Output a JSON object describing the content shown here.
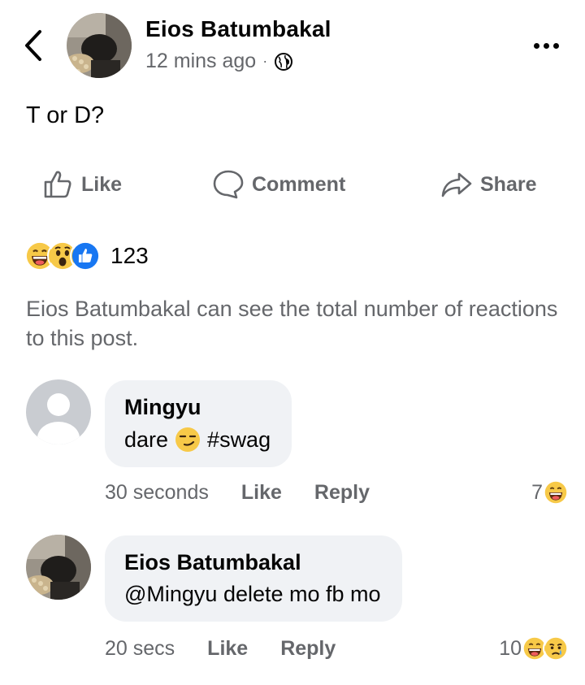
{
  "post": {
    "author": "Eios Batumbakal",
    "time": "12 mins ago",
    "dot": "·",
    "text": "T or D?"
  },
  "actions": {
    "like": "Like",
    "comment": "Comment",
    "share": "Share"
  },
  "reactions": {
    "icons": [
      "laugh-emoji",
      "wow-emoji",
      "like-thumb"
    ],
    "count": "123"
  },
  "notice": "Eios Batumbakal can see the total number of reactions to this post.",
  "comments": [
    {
      "name": "Mingyu",
      "text_before": "dare",
      "emoji": "smirk-emoji",
      "text_after": "#swag",
      "time": "30 seconds",
      "like": "Like",
      "reply": "Reply",
      "reaction_count": "7",
      "reaction_icons": [
        "laugh-emoji"
      ]
    },
    {
      "name": "Eios Batumbakal",
      "text": "@Mingyu delete mo fb mo",
      "time": "20 secs",
      "like": "Like",
      "reply": "Reply",
      "reaction_count": "10",
      "reaction_icons": [
        "laugh-emoji",
        "sad-emoji"
      ]
    }
  ],
  "colors": {
    "secondary_text": "#65676b",
    "bubble_bg": "#f0f2f5",
    "like_blue": "#1877f2",
    "emoji_yellow": "#f7c948"
  }
}
